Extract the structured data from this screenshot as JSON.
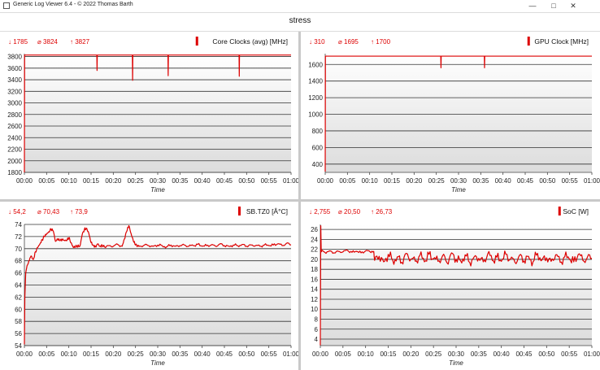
{
  "window": {
    "app_title": "Generic Log Viewer 6.4 - © 2022 Thomas Barth",
    "minimize_icon": "minimize-icon",
    "maximize_icon": "maximize-icon",
    "close_icon": "close-icon"
  },
  "header": {
    "title": "stress"
  },
  "colors": {
    "accent": "#dd0000",
    "plot_top": "#ffffff",
    "plot_bottom": "#dcdcdc",
    "grid": "#333333"
  },
  "chart_data": [
    {
      "type": "line",
      "title": "Core Clocks (avg) [MHz]",
      "stats": {
        "min": "1785",
        "avg": "3824",
        "max": "3827"
      },
      "xlabel": "Time",
      "x_ticks": [
        "00:00",
        "00:05",
        "00:10",
        "00:15",
        "00:20",
        "00:25",
        "00:30",
        "00:35",
        "00:40",
        "00:45",
        "00:50",
        "00:55",
        "01:00"
      ],
      "y_ticks": [
        "3800",
        "3600",
        "3400",
        "3200",
        "3000",
        "2800",
        "2600",
        "2400",
        "2200",
        "2000",
        "1800"
      ],
      "ylim": [
        1800,
        3850
      ],
      "xlim": [
        0,
        60
      ],
      "series": [
        {
          "x": [
            0,
            0.05,
            0.1,
            16.3,
            16.35,
            16.4,
            24.3,
            24.35,
            24.4,
            32.3,
            32.35,
            32.4,
            48.3,
            48.35,
            48.4,
            60
          ],
          "y": [
            1785,
            3827,
            3826,
            3826,
            3560,
            3826,
            3826,
            3390,
            3826,
            3826,
            3470,
            3826,
            3826,
            3460,
            3826,
            3826
          ]
        }
      ]
    },
    {
      "type": "line",
      "title": "GPU Clock [MHz]",
      "stats": {
        "min": "310",
        "avg": "1695",
        "max": "1700"
      },
      "xlabel": "Time",
      "x_ticks": [
        "00:00",
        "00:05",
        "00:10",
        "00:15",
        "00:20",
        "00:25",
        "00:30",
        "00:35",
        "00:40",
        "00:45",
        "00:50",
        "00:55",
        "01:00"
      ],
      "y_ticks": [
        "1600",
        "1400",
        "1200",
        "1000",
        "800",
        "600",
        "400"
      ],
      "ylim": [
        300,
        1730
      ],
      "xlim": [
        0,
        60
      ],
      "series": [
        {
          "x": [
            0,
            0.05,
            0.1,
            26.0,
            26.05,
            26.1,
            35.8,
            35.85,
            35.9,
            60
          ],
          "y": [
            310,
            1700,
            1700,
            1700,
            1560,
            1700,
            1700,
            1560,
            1700,
            1700
          ]
        }
      ]
    },
    {
      "type": "line",
      "title": "SB.TZ0 [Â°C]",
      "stats": {
        "min": "54,2",
        "avg": "70,43",
        "max": "73,9"
      },
      "xlabel": "Time",
      "x_ticks": [
        "00:00",
        "00:05",
        "00:10",
        "00:15",
        "00:20",
        "00:25",
        "00:30",
        "00:35",
        "00:40",
        "00:45",
        "00:50",
        "00:55",
        "01:00"
      ],
      "y_ticks": [
        "74",
        "72",
        "70",
        "68",
        "66",
        "64",
        "62",
        "60",
        "58",
        "56",
        "54"
      ],
      "ylim": [
        54,
        74
      ],
      "xlim": [
        0,
        60
      ],
      "series": [
        {
          "x": [
            0,
            0.1,
            0.3,
            0.6,
            1.0,
            1.5,
            2.0,
            2.5,
            3.0,
            3.5,
            4.0,
            4.5,
            5.0,
            5.5,
            6.0,
            6.5,
            7.0,
            7.5,
            8.0,
            8.5,
            9.0,
            9.5,
            10.0,
            10.5,
            11.0,
            11.5,
            12.0,
            12.5,
            13.0,
            13.5,
            14.0,
            14.5,
            15.0,
            15.5,
            16.0,
            16.5,
            17.0,
            17.5,
            18.0,
            19.0,
            20.0,
            21.0,
            22.0,
            22.5,
            23.0,
            23.5,
            24.0,
            24.5,
            25.0,
            25.5,
            26.0,
            27.0,
            28.0,
            29.0,
            30.0,
            31.0,
            32.0,
            33.0,
            34.0,
            35.0,
            36.0,
            37.0,
            38.0,
            39.0,
            40.0,
            41.0,
            42.0,
            43.0,
            44.0,
            45.0,
            46.0,
            47.0,
            48.0,
            49.0,
            50.0,
            51.0,
            52.0,
            53.0,
            54.0,
            55.0,
            56.0,
            57.0,
            58.0,
            59.0,
            60.0
          ],
          "y": [
            54.2,
            62.0,
            66.0,
            67.2,
            68.0,
            68.8,
            68.2,
            69.5,
            70.2,
            70.8,
            71.5,
            72.0,
            72.4,
            72.8,
            73.2,
            72.9,
            71.2,
            71.6,
            71.3,
            71.5,
            71.4,
            71.3,
            71.8,
            71.0,
            70.2,
            70.3,
            70.5,
            70.4,
            72.3,
            73.2,
            73.4,
            72.5,
            71.0,
            70.6,
            70.3,
            70.8,
            70.4,
            70.6,
            70.3,
            70.5,
            70.4,
            70.7,
            70.4,
            71.6,
            72.8,
            73.8,
            72.5,
            71.3,
            70.6,
            70.5,
            70.4,
            70.6,
            70.5,
            70.4,
            70.6,
            70.5,
            70.3,
            70.6,
            70.4,
            70.5,
            70.6,
            70.4,
            70.5,
            70.7,
            70.4,
            70.5,
            70.6,
            70.4,
            70.8,
            70.5,
            70.4,
            70.6,
            70.5,
            70.7,
            70.4,
            70.6,
            70.5,
            70.4,
            70.6,
            70.5,
            70.6,
            70.8,
            70.5,
            70.9,
            70.6
          ]
        }
      ]
    },
    {
      "type": "line",
      "title": "SoC [W]",
      "stats": {
        "min": "2,755",
        "avg": "20,50",
        "max": "26,73"
      },
      "xlabel": "Time",
      "x_ticks": [
        "00:00",
        "00:05",
        "00:10",
        "00:15",
        "00:20",
        "00:25",
        "00:30",
        "00:35",
        "00:40",
        "00:45",
        "00:50",
        "00:55",
        "01:00"
      ],
      "y_ticks": [
        "26",
        "24",
        "22",
        "20",
        "18",
        "16",
        "14",
        "12",
        "10",
        "8",
        "6",
        "4"
      ],
      "ylim": [
        2.7,
        27
      ],
      "xlim": [
        0,
        60
      ],
      "series": [
        {
          "x": [
            0,
            0.1,
            0.2,
            0.4,
            1.0,
            2.0,
            3.0,
            4.0,
            5.0,
            6.0,
            7.0,
            8.0,
            9.0,
            10.0,
            11.0,
            11.8,
            12.0,
            13.0,
            14.0,
            15.0,
            16.0,
            17.0,
            18.0,
            19.0,
            20.0,
            21.0,
            22.0,
            23.0,
            24.0,
            25.0,
            26.0,
            27.0,
            28.0,
            29.0,
            30.0,
            31.0,
            32.0,
            33.0,
            34.0,
            35.0,
            36.0,
            37.0,
            38.0,
            39.0,
            40.0,
            41.0,
            42.0,
            43.0,
            44.0,
            45.0,
            46.0,
            47.0,
            48.0,
            49.0,
            50.0,
            51.0,
            52.0,
            53.0,
            54.0,
            55.0,
            56.0,
            57.0,
            58.0,
            59.0,
            60.0
          ],
          "y": [
            2.755,
            26.73,
            21.5,
            21.8,
            21.4,
            21.7,
            21.3,
            21.6,
            21.5,
            21.8,
            21.4,
            21.6,
            21.3,
            21.7,
            21.5,
            21.6,
            19.8,
            20.6,
            19.5,
            21.0,
            19.8,
            20.5,
            19.4,
            21.2,
            20.0,
            19.6,
            20.8,
            19.5,
            21.0,
            20.1,
            19.6,
            20.7,
            19.3,
            21.3,
            20.0,
            19.7,
            20.9,
            19.4,
            20.5,
            20.2,
            19.5,
            21.1,
            19.8,
            20.4,
            19.6,
            21.0,
            20.0,
            19.4,
            20.8,
            19.7,
            20.6,
            19.5,
            21.2,
            19.9,
            20.3,
            19.6,
            20.9,
            19.4,
            20.5,
            20.1,
            19.5,
            21.0,
            19.8,
            20.4,
            20.2
          ]
        }
      ]
    }
  ]
}
